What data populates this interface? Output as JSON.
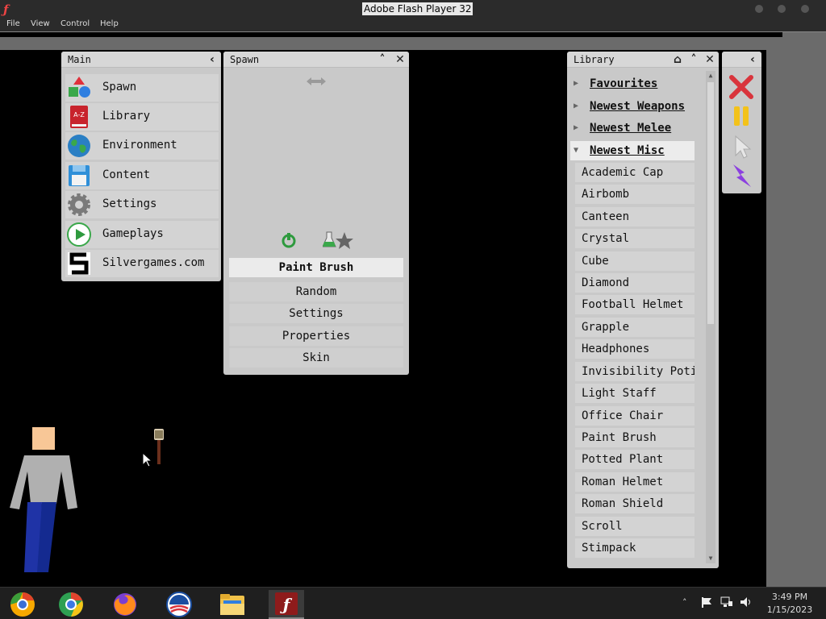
{
  "window": {
    "title": "Adobe Flash Player 32",
    "app_icon": "flash-icon"
  },
  "menubar": {
    "items": [
      "File",
      "View",
      "Control",
      "Help"
    ]
  },
  "panels": {
    "main": {
      "title": "Main",
      "items": [
        {
          "label": "Spawn",
          "icon": "shapes-icon"
        },
        {
          "label": "Library",
          "icon": "book-icon"
        },
        {
          "label": "Environment",
          "icon": "globe-icon"
        },
        {
          "label": "Content",
          "icon": "floppy-disk-icon"
        },
        {
          "label": "Settings",
          "icon": "gear-icon"
        },
        {
          "label": "Gameplays",
          "icon": "play-icon"
        },
        {
          "label": "Silvergames.com",
          "icon": "silvergames-logo-icon"
        }
      ]
    },
    "spawn": {
      "title": "Spawn",
      "selected_tool": "Paint Brush",
      "buttons": [
        "Random",
        "Settings",
        "Properties",
        "Skin"
      ]
    },
    "library": {
      "title": "Library",
      "categories": [
        {
          "label": "Favourites",
          "open": false
        },
        {
          "label": "Newest Weapons",
          "open": false
        },
        {
          "label": "Newest Melee",
          "open": false
        },
        {
          "label": "Newest Misc",
          "open": true
        }
      ],
      "items": [
        "Academic Cap",
        "Airbomb",
        "Canteen",
        "Crystal",
        "Cube",
        "Diamond",
        "Football Helmet",
        "Grapple",
        "Headphones",
        "Invisibility Potion",
        "Light Staff",
        "Office Chair",
        "Paint Brush",
        "Potted Plant",
        "Roman Helmet",
        "Roman Shield",
        "Scroll",
        "Stimpack"
      ]
    },
    "toolbox": {
      "tools": [
        "delete-x-icon",
        "pause-icon",
        "select-cursor-icon",
        "lightning-icon"
      ]
    }
  },
  "taskbar": {
    "apps": [
      "chrome-canary-icon",
      "chrome-icon",
      "firefox-icon",
      "obama-logo-icon",
      "file-explorer-icon",
      "flash-player-icon"
    ],
    "time": "3:49 PM",
    "date": "1/15/2023"
  },
  "colors": {
    "panel_bg": "#c9c9c9",
    "item_bg": "#d3d3d3",
    "canvas": "#000000",
    "stage_border": "#6b6b6b"
  }
}
